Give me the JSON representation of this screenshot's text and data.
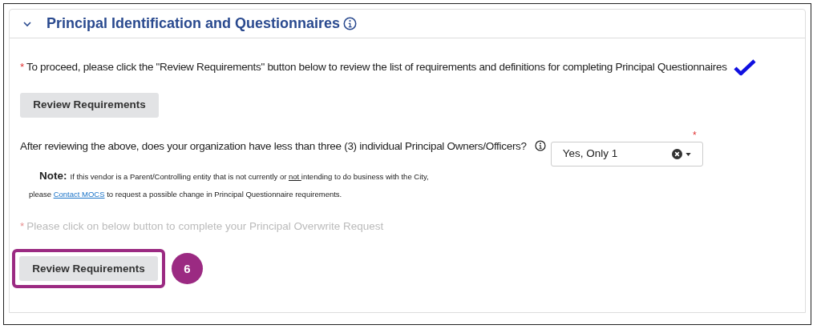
{
  "section": {
    "title": "Principal Identification and Questionnaires",
    "expanded": true
  },
  "instruction": {
    "required_mark": "*",
    "text": "To proceed, please click the \"Review Requirements\" button below to review the list of requirements and definitions for completing Principal Questionnaires",
    "completed": true
  },
  "review_button": {
    "label": "Review Requirements"
  },
  "question": {
    "label": "After reviewing the above, does your organization have less than three (3) individual Principal Owners/Officers?",
    "required_mark": "*",
    "value": "Yes, Only 1"
  },
  "note": {
    "heading": "Note:",
    "line_1": [
      {
        "kind": "text",
        "text": "If this vendor is a Parent/Controlling entity that is not currently or "
      },
      {
        "kind": "underline",
        "text": "not "
      },
      {
        "kind": "text",
        "text": "intending to do business with the City,"
      }
    ],
    "line_2": [
      {
        "kind": "text",
        "text": "please "
      },
      {
        "kind": "link",
        "text": "Contact MOCS"
      },
      {
        "kind": "text",
        "text": " to request a possible change in Principal Questionnaire requirements."
      }
    ]
  },
  "overwrite": {
    "required_mark": "*",
    "text": "Please click on below button to complete your Principal Overwrite Request",
    "disabled": true
  },
  "overwrite_button": {
    "label": "Review Requirements",
    "highlighted": true
  },
  "callout": {
    "number": "6"
  }
}
